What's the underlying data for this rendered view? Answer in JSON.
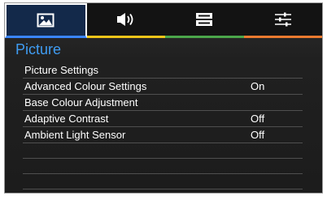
{
  "tabs": [
    {
      "name": "picture-tab",
      "icon": "picture-icon",
      "active": true,
      "accent": "#3a86ff"
    },
    {
      "name": "sound-tab",
      "icon": "speaker-icon",
      "active": false,
      "accent": "#f0c419"
    },
    {
      "name": "setup-tab",
      "icon": "settings-box-icon",
      "active": false,
      "accent": "#4ba64a"
    },
    {
      "name": "options-tab",
      "icon": "sliders-icon",
      "active": false,
      "accent": "#ec7a2f"
    }
  ],
  "menu": {
    "title": "Picture",
    "items": [
      {
        "label": "Picture Settings",
        "value": ""
      },
      {
        "label": "Advanced Colour Settings",
        "value": "On"
      },
      {
        "label": "Base Colour Adjustment",
        "value": ""
      },
      {
        "label": "Adaptive Contrast",
        "value": "Off"
      },
      {
        "label": "Ambient Light Sensor",
        "value": "Off"
      }
    ]
  },
  "colors": {
    "title": "#3f9cf2",
    "background": "#202020",
    "text": "#ffffff"
  }
}
